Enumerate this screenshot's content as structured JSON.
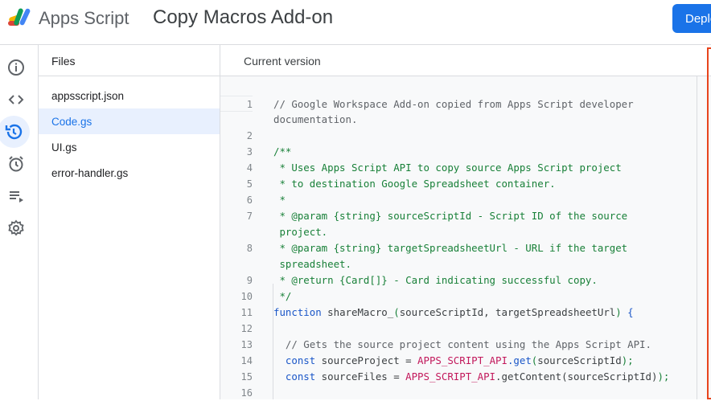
{
  "header": {
    "app_name": "Apps Script",
    "project_title": "Copy Macros Add-on",
    "deploy_label": "Deploy"
  },
  "rail": [
    {
      "name": "overview-icon"
    },
    {
      "name": "editor-icon"
    },
    {
      "name": "history-icon",
      "active": true
    },
    {
      "name": "triggers-icon"
    },
    {
      "name": "executions-icon"
    },
    {
      "name": "settings-icon"
    }
  ],
  "files": {
    "title": "Files",
    "items": [
      {
        "label": "appsscript.json"
      },
      {
        "label": "Code.gs",
        "active": true
      },
      {
        "label": "UI.gs"
      },
      {
        "label": "error-handler.gs"
      }
    ]
  },
  "main": {
    "title": "Current version"
  },
  "code_rows": [
    {
      "num": "1",
      "cur": true,
      "tokens": [
        {
          "t": "// Google Workspace Add-on copied from Apps Script developer",
          "c": "comment"
        }
      ]
    },
    {
      "num": "",
      "tokens": [
        {
          "t": "documentation.",
          "c": "comment"
        }
      ]
    },
    {
      "num": "2",
      "tokens": []
    },
    {
      "num": "3",
      "tokens": [
        {
          "t": "/**",
          "c": "doc"
        }
      ]
    },
    {
      "num": "4",
      "tokens": [
        {
          "t": " * Uses Apps Script API to copy source Apps Script project",
          "c": "doc"
        }
      ]
    },
    {
      "num": "5",
      "tokens": [
        {
          "t": " * to destination Google Spreadsheet container.",
          "c": "doc"
        }
      ]
    },
    {
      "num": "6",
      "tokens": [
        {
          "t": " *",
          "c": "doc"
        }
      ]
    },
    {
      "num": "7",
      "tokens": [
        {
          "t": " * @param {string} sourceScriptId - Script ID of the source",
          "c": "doc"
        }
      ]
    },
    {
      "num": "",
      "tokens": [
        {
          "t": " project.",
          "c": "doc"
        }
      ]
    },
    {
      "num": "8",
      "tokens": [
        {
          "t": " * @param {string} targetSpreadsheetUrl - URL if the target",
          "c": "doc"
        }
      ]
    },
    {
      "num": "",
      "tokens": [
        {
          "t": " spreadsheet.",
          "c": "doc"
        }
      ]
    },
    {
      "num": "9",
      "tokens": [
        {
          "t": " * @return {Card[]} - Card indicating successful copy.",
          "c": "doc"
        }
      ]
    },
    {
      "num": "10",
      "tokens": [
        {
          "t": " */",
          "c": "doc"
        }
      ]
    },
    {
      "num": "11",
      "tokens": [
        {
          "t": "function",
          "c": "kw"
        },
        {
          "t": " shareMacro_",
          "c": ""
        },
        {
          "t": "(",
          "c": "paren"
        },
        {
          "t": "sourceScriptId, targetSpreadsheetUrl",
          "c": ""
        },
        {
          "t": ")",
          "c": "paren"
        },
        {
          "t": " {",
          "c": "kw"
        }
      ]
    },
    {
      "num": "12",
      "tokens": []
    },
    {
      "num": "13",
      "tokens": [
        {
          "t": "  // Gets the source project content using the Apps Script API.",
          "c": "comment"
        }
      ]
    },
    {
      "num": "14",
      "tokens": [
        {
          "t": "  const",
          "c": "kw"
        },
        {
          "t": " sourceProject = ",
          "c": ""
        },
        {
          "t": "APPS_SCRIPT_API",
          "c": "const"
        },
        {
          "t": ".get",
          "c": "kw"
        },
        {
          "t": "(",
          "c": "paren"
        },
        {
          "t": "sourceScriptId",
          "c": ""
        },
        {
          "t": ");",
          "c": "paren"
        }
      ]
    },
    {
      "num": "15",
      "tokens": [
        {
          "t": "  const",
          "c": "kw"
        },
        {
          "t": " sourceFiles = ",
          "c": ""
        },
        {
          "t": "APPS_SCRIPT_API",
          "c": "const"
        },
        {
          "t": ".getContent(sourceScriptId)",
          "c": ""
        },
        {
          "t": ");",
          "c": "paren"
        }
      ]
    },
    {
      "num": "16",
      "tokens": []
    }
  ]
}
